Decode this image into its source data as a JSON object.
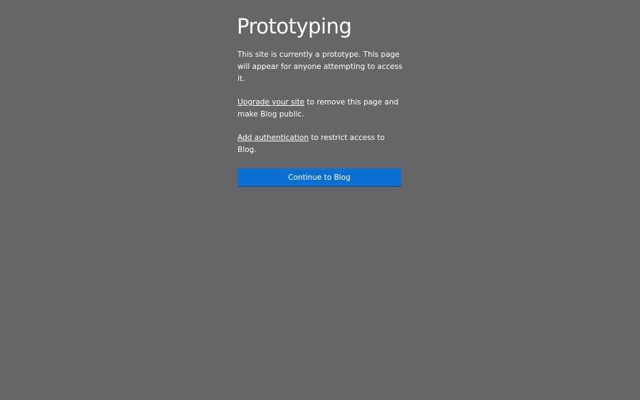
{
  "title": "Prototyping",
  "intro": "This site is currently a prototype. This page will appear for anyone attempting to access it.",
  "upgrade": {
    "link_text": "Upgrade your site",
    "rest_text": " to remove this page and make Blog public."
  },
  "auth": {
    "link_text": "Add authentication",
    "rest_text": " to restrict access to Blog."
  },
  "continue_button": "Continue to Blog",
  "colors": {
    "background": "#666666",
    "button": "#0b6ed0",
    "text": "#ffffff"
  }
}
